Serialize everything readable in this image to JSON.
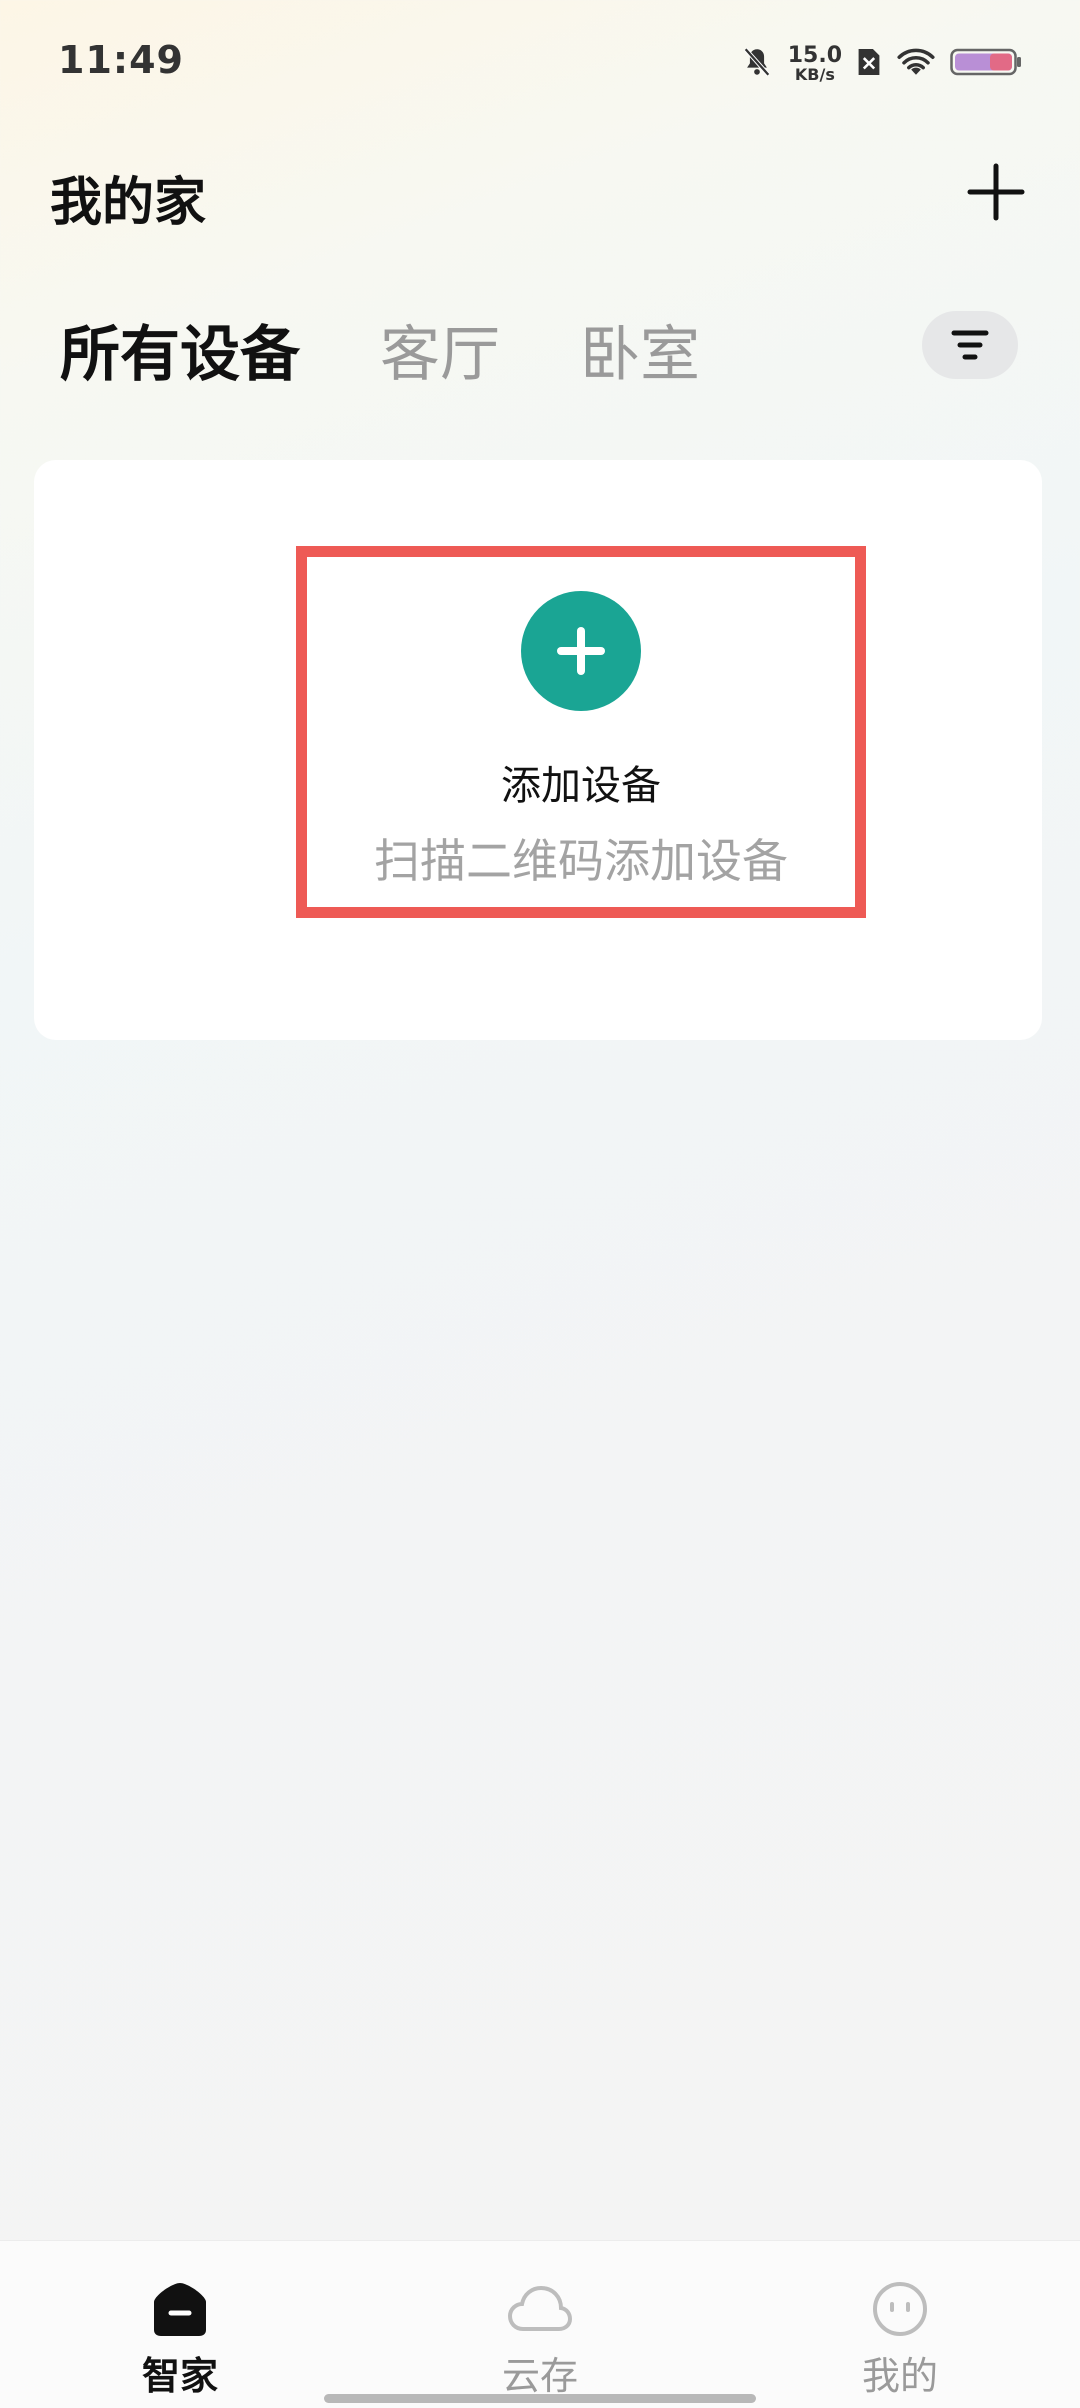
{
  "status_bar": {
    "time": "11:49",
    "net_speed_value": "15.0",
    "net_speed_unit": "KB/s"
  },
  "header": {
    "title": "我的家"
  },
  "tabs": [
    {
      "label": "所有设备",
      "active": true
    },
    {
      "label": "客厅",
      "active": false
    },
    {
      "label": "卧室",
      "active": false
    }
  ],
  "add_device": {
    "title": "添加设备",
    "subtitle": "扫描二维码添加设备"
  },
  "bottom_nav": [
    {
      "label": "智家",
      "icon": "home-icon",
      "active": true
    },
    {
      "label": "云存",
      "icon": "cloud-icon",
      "active": false
    },
    {
      "label": "我的",
      "icon": "profile-face-icon",
      "active": false
    }
  ],
  "colors": {
    "accent": "#1aa594",
    "highlight_border": "#ee5a55"
  }
}
